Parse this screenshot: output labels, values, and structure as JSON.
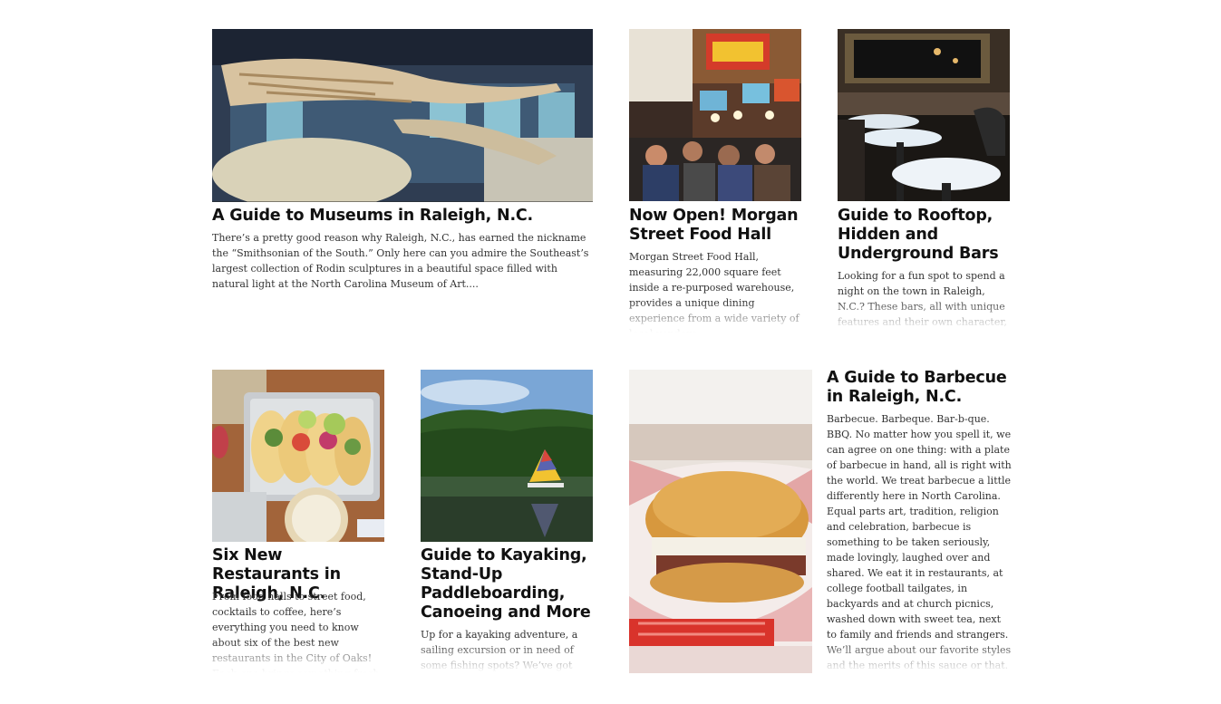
{
  "articles": [
    {
      "title": "A Guide to Museums in Raleigh, N.C.",
      "excerpt": "There’s a pretty good reason why Raleigh, N.C., has earned the nickname the “Smithsonian of the South.” Only here can you admire the Southeast’s largest collection of Rodin sculptures in a beautiful space filled with natural light at the North Carolina Museum of Art...."
    },
    {
      "title": "Now Open! Morgan Street Food Hall",
      "excerpt": "Morgan Street Food Hall, measuring 22,000 square feet inside a re-purposed warehouse, provides a unique dining experience from a wide variety of local vendors."
    },
    {
      "title": "Guide to Rooftop, Hidden and Underground Bars",
      "excerpt": "Looking for a fun spot to spend a night on the town in Raleigh, N.C.? These bars, all with unique features and their own character, offer something for everyone."
    },
    {
      "title": "Six New Restaurants in Raleigh, N.C.",
      "excerpt": "From food halls to street food, cocktails to coffee, here’s everything you need to know about six of the best new restaurants in the City of Oaks! Each one brings something fresh to the table."
    },
    {
      "title": "Guide to Kayaking, Stand-Up Paddleboarding, Canoeing and More",
      "excerpt": "Up for a kayaking adventure, a sailing excursion or in need of some fishing spots? We’ve got you covered on the water."
    },
    {
      "title": "A Guide to Barbecue in Raleigh, N.C.",
      "excerpt": "Barbecue. Barbeque. Bar-b-que. BBQ. No matter how you spell it, we can agree on one thing: with a plate of barbecue in hand, all is right with the world. We treat barbecue a little differently here in North Carolina. Equal parts art, tradition, religion and celebration, barbecue is something to be taken seriously, made lovingly, laughed over and shared. We eat it in restaurants, at college football tailgates, in backyards and at church picnics, washed down with sweet tea, next to family and friends and strangers. We’ll argue about our favorite styles and the merits of this sauce or that."
    }
  ]
}
